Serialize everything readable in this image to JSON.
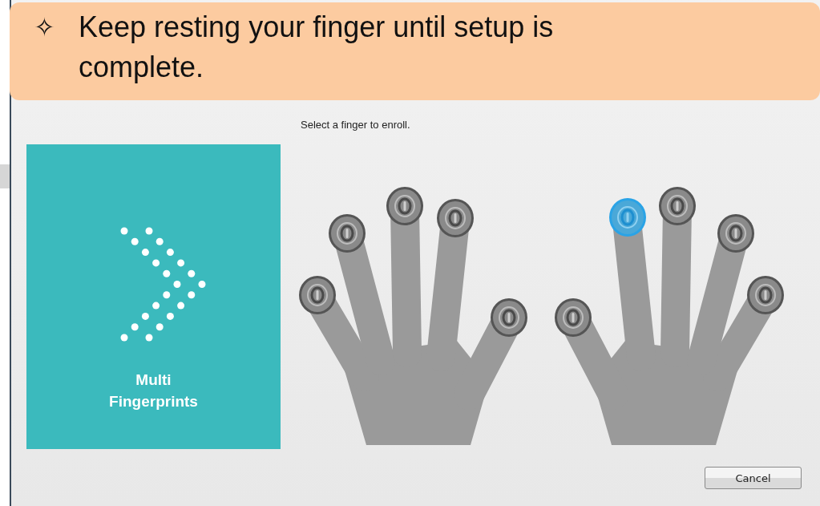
{
  "callout": {
    "icon": "✧",
    "text": "Keep resting your finger until setup is complete."
  },
  "dialog": {
    "instruction": "Select a finger to enroll.",
    "mode_panel": {
      "label": "Multi Fingerprints"
    },
    "hands": [
      {
        "fingers": [
          {
            "selected": false
          },
          {
            "selected": false
          },
          {
            "selected": false
          },
          {
            "selected": false
          },
          {
            "selected": false
          }
        ]
      },
      {
        "fingers": [
          {
            "selected": false
          },
          {
            "selected": true
          },
          {
            "selected": false
          },
          {
            "selected": false
          },
          {
            "selected": false
          }
        ]
      }
    ],
    "buttons": [
      {
        "label": "Cancel"
      }
    ]
  }
}
